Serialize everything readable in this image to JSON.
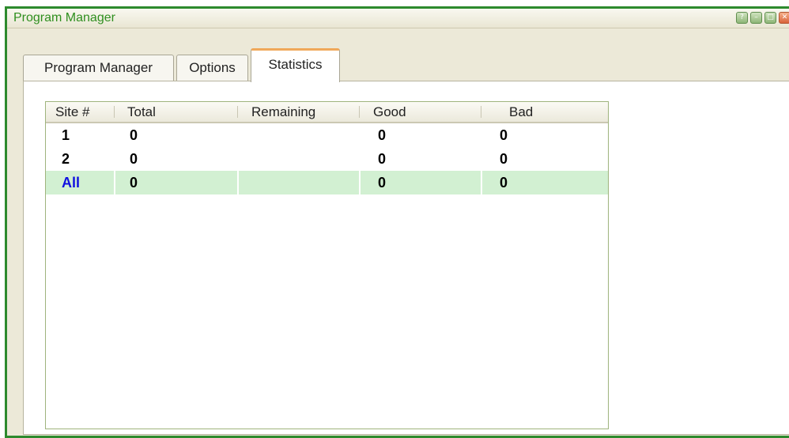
{
  "window": {
    "title": "Program Manager",
    "buttons": [
      {
        "name": "help",
        "glyph": "?"
      },
      {
        "name": "minimize",
        "glyph": "–"
      },
      {
        "name": "maximize",
        "glyph": "□"
      },
      {
        "name": "close",
        "glyph": "✕"
      }
    ]
  },
  "tabs": [
    {
      "label": "Program Manager",
      "active": false
    },
    {
      "label": "Options",
      "active": false
    },
    {
      "label": "Statistics",
      "active": true
    }
  ],
  "grid": {
    "columns": [
      "Site #",
      "Total",
      "Remaining",
      "Good",
      "Bad"
    ],
    "rows": [
      {
        "site": "1",
        "total": "0",
        "remaining": "",
        "good": "0",
        "bad": "0"
      },
      {
        "site": "2",
        "total": "0",
        "remaining": "",
        "good": "0",
        "bad": "0"
      },
      {
        "site": "All",
        "total": "0",
        "remaining": "",
        "good": "0",
        "bad": "0",
        "highlight": true
      }
    ]
  },
  "colors": {
    "window_border": "#2d8a2d",
    "title_text": "#2f8f1f",
    "active_tab_accent": "#f0a85a",
    "all_row_highlight": "#d2f0d2",
    "all_label": "#1010e0"
  }
}
